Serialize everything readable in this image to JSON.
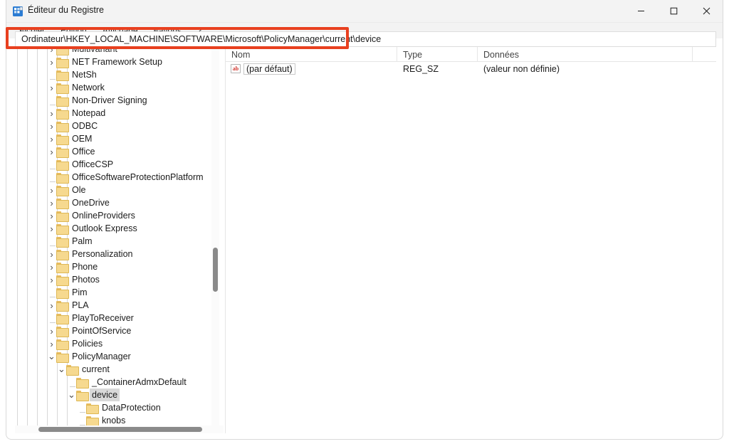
{
  "window": {
    "title": "Éditeur du Registre",
    "icon": "registry-editor-icon",
    "minimize_label": "—",
    "maximize_label": "☐",
    "close_label": "✕"
  },
  "menubar": {
    "items": [
      {
        "label": "Fichier"
      },
      {
        "label": "Edition"
      },
      {
        "label": "Affichage"
      },
      {
        "label": "Favoris"
      },
      {
        "label": "?"
      }
    ]
  },
  "address": {
    "value": "Ordinateur\\HKEY_LOCAL_MACHINE\\SOFTWARE\\Microsoft\\PolicyManager\\current\\device",
    "placeholder": "Ordinateur\\"
  },
  "annotation": {
    "color": "#e8401f",
    "target": "address-bar"
  },
  "tree": {
    "items": [
      {
        "label": "Multivariant",
        "depth": 4,
        "chevron": "collapsed",
        "selected": false,
        "partial": true
      },
      {
        "label": "NET Framework Setup",
        "depth": 4,
        "chevron": "collapsed",
        "selected": false
      },
      {
        "label": "NetSh",
        "depth": 4,
        "chevron": "none",
        "selected": false
      },
      {
        "label": "Network",
        "depth": 4,
        "chevron": "collapsed",
        "selected": false
      },
      {
        "label": "Non-Driver Signing",
        "depth": 4,
        "chevron": "none",
        "selected": false
      },
      {
        "label": "Notepad",
        "depth": 4,
        "chevron": "collapsed",
        "selected": false
      },
      {
        "label": "ODBC",
        "depth": 4,
        "chevron": "collapsed",
        "selected": false
      },
      {
        "label": "OEM",
        "depth": 4,
        "chevron": "collapsed",
        "selected": false
      },
      {
        "label": "Office",
        "depth": 4,
        "chevron": "collapsed",
        "selected": false
      },
      {
        "label": "OfficeCSP",
        "depth": 4,
        "chevron": "none",
        "selected": false
      },
      {
        "label": "OfficeSoftwareProtectionPlatform",
        "depth": 4,
        "chevron": "none",
        "selected": false
      },
      {
        "label": "Ole",
        "depth": 4,
        "chevron": "collapsed",
        "selected": false
      },
      {
        "label": "OneDrive",
        "depth": 4,
        "chevron": "collapsed",
        "selected": false
      },
      {
        "label": "OnlineProviders",
        "depth": 4,
        "chevron": "collapsed",
        "selected": false
      },
      {
        "label": "Outlook Express",
        "depth": 4,
        "chevron": "collapsed",
        "selected": false
      },
      {
        "label": "Palm",
        "depth": 4,
        "chevron": "none",
        "selected": false
      },
      {
        "label": "Personalization",
        "depth": 4,
        "chevron": "collapsed",
        "selected": false
      },
      {
        "label": "Phone",
        "depth": 4,
        "chevron": "collapsed",
        "selected": false
      },
      {
        "label": "Photos",
        "depth": 4,
        "chevron": "collapsed",
        "selected": false
      },
      {
        "label": "Pim",
        "depth": 4,
        "chevron": "none",
        "selected": false
      },
      {
        "label": "PLA",
        "depth": 4,
        "chevron": "collapsed",
        "selected": false
      },
      {
        "label": "PlayToReceiver",
        "depth": 4,
        "chevron": "none",
        "selected": false
      },
      {
        "label": "PointOfService",
        "depth": 4,
        "chevron": "collapsed",
        "selected": false
      },
      {
        "label": "Policies",
        "depth": 4,
        "chevron": "collapsed",
        "selected": false
      },
      {
        "label": "PolicyManager",
        "depth": 4,
        "chevron": "expanded",
        "selected": false
      },
      {
        "label": "current",
        "depth": 5,
        "chevron": "expanded",
        "selected": false
      },
      {
        "label": "_ContainerAdmxDefault",
        "depth": 6,
        "chevron": "none",
        "selected": false
      },
      {
        "label": "device",
        "depth": 6,
        "chevron": "expanded",
        "selected": true
      },
      {
        "label": "DataProtection",
        "depth": 7,
        "chevron": "none",
        "selected": false
      },
      {
        "label": "knobs",
        "depth": 7,
        "chevron": "none",
        "selected": false
      }
    ]
  },
  "list": {
    "columns": [
      {
        "label": "Nom"
      },
      {
        "label": "Type"
      },
      {
        "label": "Données"
      },
      {
        "label": ""
      }
    ],
    "rows": [
      {
        "icon": "string-value-icon",
        "icon_text": "ab",
        "name": "(par défaut)",
        "type": "REG_SZ",
        "data": "(valeur non définie)"
      }
    ]
  }
}
